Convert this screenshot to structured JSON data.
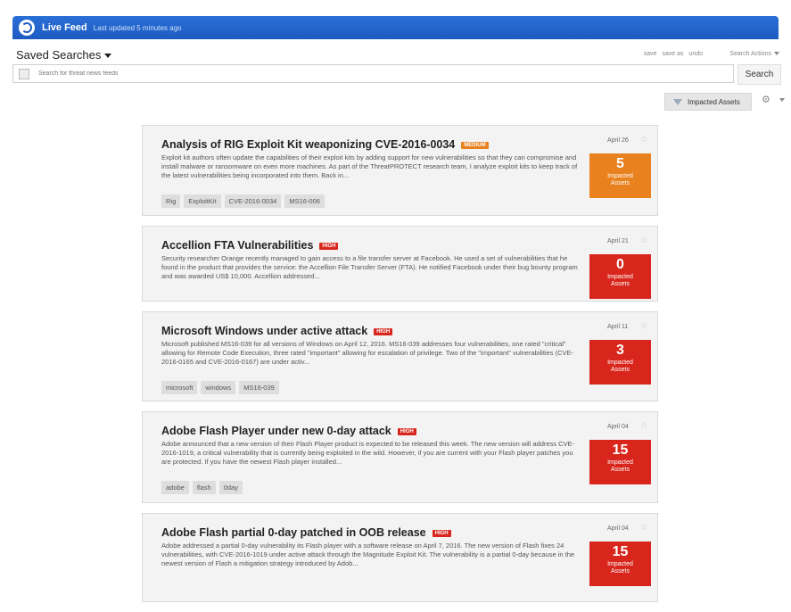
{
  "header": {
    "title": "Live Feed",
    "updated": "Last updated 5 minutes ago"
  },
  "saved_searches": {
    "title": "Saved Searches",
    "save": "save",
    "save_as": "save as",
    "undo": "undo",
    "search_actions": "Search Actions"
  },
  "search": {
    "placeholder": "Search for threat news feeds",
    "button": "Search"
  },
  "filter": {
    "impacted_assets": "Impacted Assets"
  },
  "colors": {
    "medium": "#e8811e",
    "high": "#d8261c"
  },
  "cards": [
    {
      "title": "Analysis of RIG Exploit Kit weaponizing CVE-2016-0034",
      "severity": "MEDIUM",
      "text": "Exploit kit authors often update the capabilities of their exploit kits by adding support for new vulnerabilities so that they can compromise and install malware or ransomware on even more machines. As part of the ThreatPROTECT research team, I analyze exploit kits to keep track of the latest vulnerabilities being incorporated into them. Back in...",
      "tags": [
        "Rig",
        "ExploitKit",
        "CVE-2016-0034",
        "MS16-006"
      ],
      "date": "April 26",
      "impacted": "5",
      "impacted_label": "Impacted Assets"
    },
    {
      "title": "Accellion FTA Vulnerabilities",
      "severity": "HIGH",
      "text": "Security researcher Orange recently managed to gain access to a file transfer server at Facebook. He used a set of vulnerabilities that he found in the product that provides the service: the Accellion File Transfer Server (FTA). He notified Facebook under their bug bounty program and was awarded US$ 10,000. Accellion addressed...",
      "tags": [],
      "date": "April 21",
      "impacted": "0",
      "impacted_label": "Impacted Assets"
    },
    {
      "title": "Microsoft Windows under active attack",
      "severity": "HIGH",
      "text": "Microsoft published MS16-039 for all versions of Windows on April 12, 2016. MS16-039 addresses four vulnerabilities, one rated \"critical\" allowing for Remote Code Execution, three rated \"important\" allowing for escalation of privilege. Two of the \"important\" vulnerabilities (CVE-2016-0165 and CVE-2016-0167) are under activ...",
      "tags": [
        "microsoft",
        "windows",
        "MS16-039"
      ],
      "date": "April 11",
      "impacted": "3",
      "impacted_label": "Impacted Assets"
    },
    {
      "title": "Adobe Flash Player under new 0-day attack",
      "severity": "HIGH",
      "text": "Adobe announced that a new version of their Flash Player product is expected to be released this week. The new version will address CVE-2016-1019, a critical vulnerability that is currently being exploited in the wild. However, if you are current with your Flash player patches you are protected. If you have the newest Flash player installed...",
      "tags": [
        "adobe",
        "flash",
        "0day"
      ],
      "date": "April 04",
      "impacted": "15",
      "impacted_label": "Impacted Assets"
    },
    {
      "title": "Adobe Flash partial 0-day patched in OOB release",
      "severity": "HIGH",
      "text": "Adobe addressed a partial 0-day vulnerability its Flash player with a software release on April 7, 2016. The new version of Flash fixes 24 vulnerabilities, with CVE-2016-1019 under active attack through the Magnitude Exploit Kit. The vulnerability is a partial 0-day because in the newest version of Flash a mitigation strategy introduced by Adob...",
      "tags": [],
      "date": "April 04",
      "impacted": "15",
      "impacted_label": "Impacted Assets"
    }
  ]
}
